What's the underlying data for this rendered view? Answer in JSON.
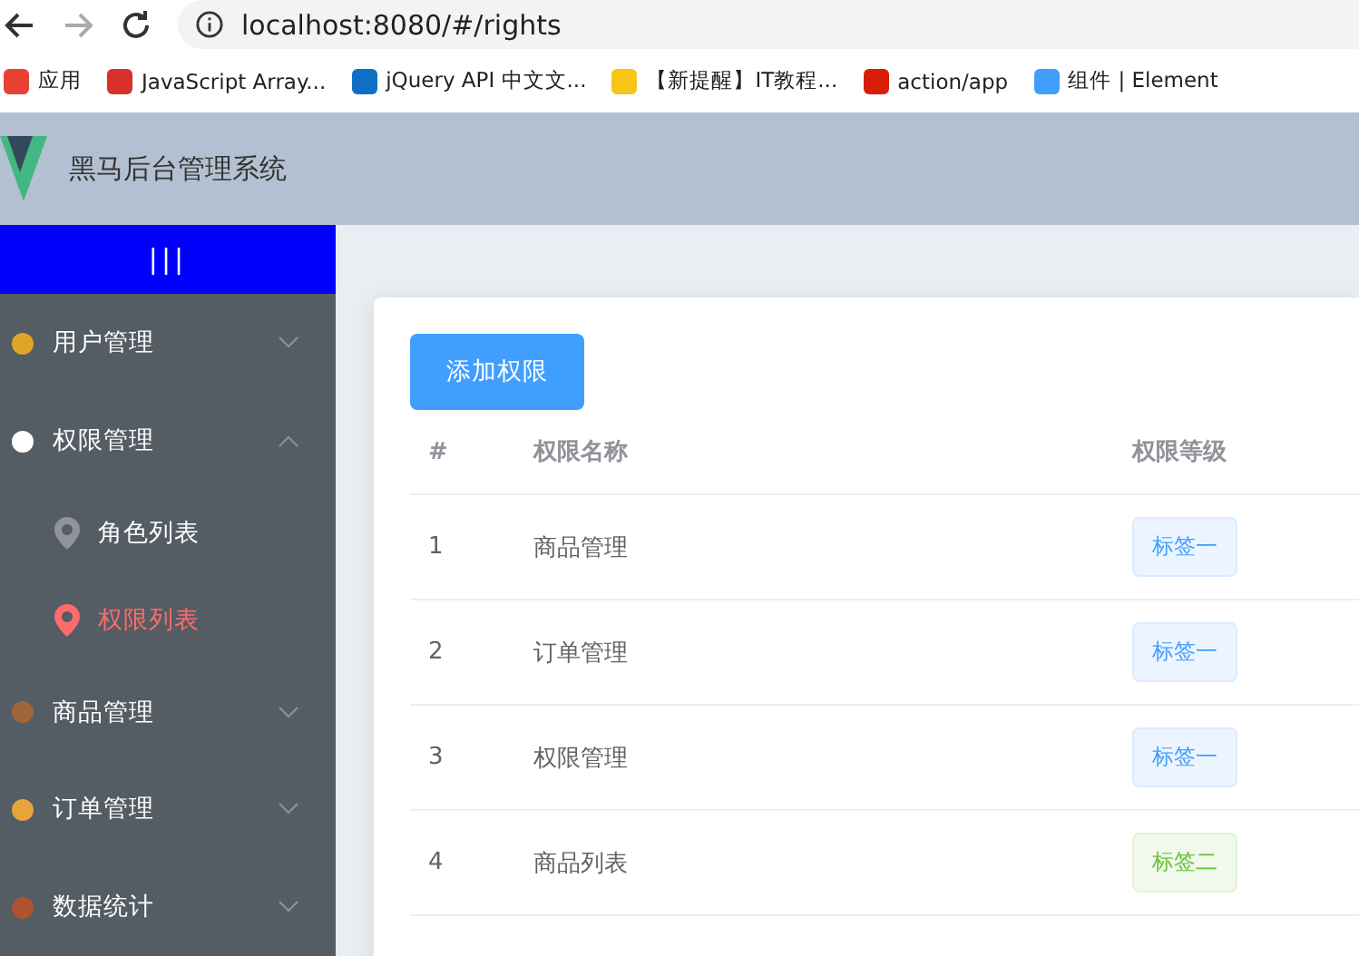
{
  "browser": {
    "url": "localhost:8080/#/rights",
    "bookmarks": [
      {
        "label": "应用",
        "color": "#e94235"
      },
      {
        "label": "JavaScript Array...",
        "color": "#d9302b"
      },
      {
        "label": "jQuery API 中文文...",
        "color": "#0e6fc4"
      },
      {
        "label": "【新提醒】IT教程...",
        "color": "#f5c518"
      },
      {
        "label": "action/app",
        "color": "#d81e06"
      },
      {
        "label": "组件 | Element",
        "color": "#409eff"
      }
    ]
  },
  "header": {
    "title": "黑马后台管理系统"
  },
  "sidebar": {
    "toggle": "|||",
    "menus": [
      {
        "label": "用户管理",
        "expanded": false,
        "color": "#e0a526"
      },
      {
        "label": "权限管理",
        "expanded": true,
        "color": "#ffffff",
        "children": [
          {
            "label": "角色列表",
            "selected": false
          },
          {
            "label": "权限列表",
            "selected": true
          }
        ]
      },
      {
        "label": "商品管理",
        "expanded": false,
        "color": "#a0663a"
      },
      {
        "label": "订单管理",
        "expanded": false,
        "color": "#e8a33c"
      },
      {
        "label": "数据统计",
        "expanded": false,
        "color": "#b0522e"
      }
    ]
  },
  "main": {
    "add_button": "添加权限",
    "table": {
      "columns": [
        "#",
        "权限名称",
        "权限等级"
      ],
      "rows": [
        {
          "index": "1",
          "name": "商品管理",
          "level": {
            "label": "标签一",
            "kind": "primary"
          }
        },
        {
          "index": "2",
          "name": "订单管理",
          "level": {
            "label": "标签一",
            "kind": "primary"
          }
        },
        {
          "index": "3",
          "name": "权限管理",
          "level": {
            "label": "标签一",
            "kind": "primary"
          }
        },
        {
          "index": "4",
          "name": "商品列表",
          "level": {
            "label": "标签二",
            "kind": "success"
          }
        }
      ]
    }
  }
}
